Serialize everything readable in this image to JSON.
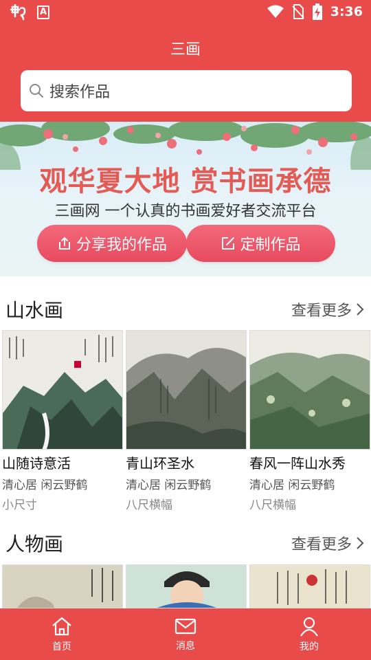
{
  "status_bar": {
    "time": "3:36",
    "app_badge": "A"
  },
  "header": {
    "title": "三画"
  },
  "search": {
    "placeholder": "搜索作品"
  },
  "banner": {
    "slogan": "观华夏大地 赏书画承德",
    "subtitle": "三画网 一个认真的书画爱好者交流平台",
    "share_button": "分享我的作品",
    "custom_button": "定制作品"
  },
  "sections": [
    {
      "title": "山水画",
      "more": "查看更多",
      "items": [
        {
          "title": "山随诗意活",
          "author": "清心居 闲云野鹤",
          "size": "小尺寸"
        },
        {
          "title": "青山环圣水",
          "author": "清心居 闲云野鹤",
          "size": "八尺横幅"
        },
        {
          "title": "春风一阵山水秀",
          "author": "清心居 闲云野鹤",
          "size": "八尺横幅"
        }
      ]
    },
    {
      "title": "人物画",
      "more": "查看更多"
    }
  ],
  "bottom_nav": {
    "home": "首页",
    "messages": "消息",
    "mine": "我的"
  },
  "colors": {
    "primary": "#e94b4b",
    "slogan": "#e25b55",
    "button": "#ee5a6c"
  },
  "icons": [
    "app-logo-icon",
    "app-badge-icon",
    "wifi-icon",
    "no-sim-icon",
    "battery-charging-icon",
    "search-icon",
    "share-icon",
    "edit-icon",
    "chevron-right-icon",
    "home-icon",
    "mail-icon",
    "user-icon"
  ]
}
